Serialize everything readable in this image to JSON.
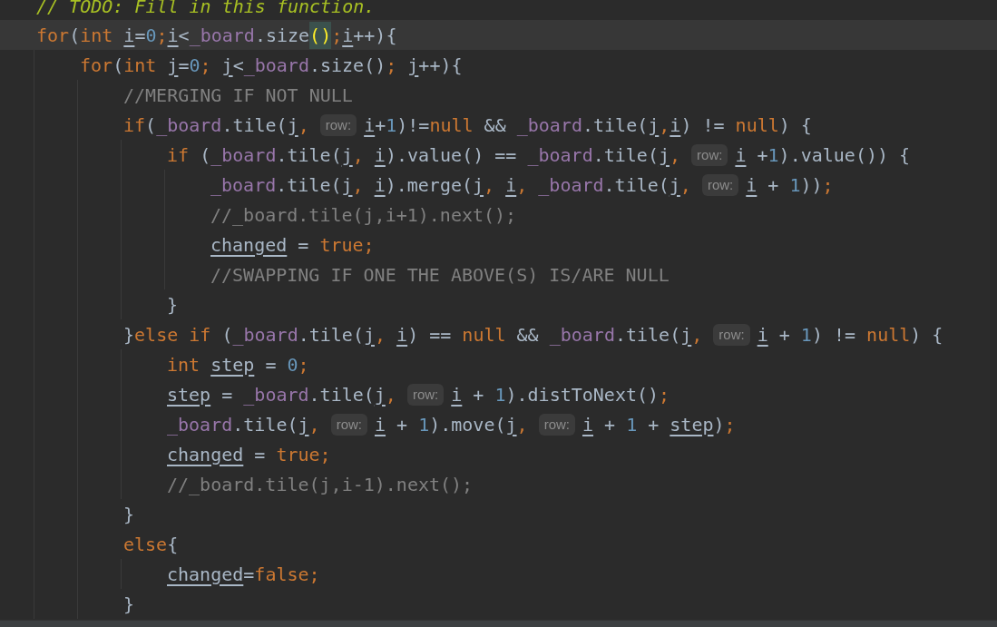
{
  "editor": {
    "lines": [
      {
        "current": false,
        "tokens": [
          {
            "text": "// TODO: Fill in this function.",
            "kind": "todo"
          }
        ]
      },
      {
        "current": true,
        "tokens": [
          {
            "text": "for",
            "kind": "kw"
          },
          {
            "text": "(",
            "kind": "text"
          },
          {
            "text": "int ",
            "kind": "kw"
          },
          {
            "text": "i",
            "kind": "var"
          },
          {
            "text": "=",
            "kind": "text"
          },
          {
            "text": "0",
            "kind": "num"
          },
          {
            "text": ";",
            "kind": "punct"
          },
          {
            "text": "i",
            "kind": "var"
          },
          {
            "text": "<",
            "kind": "text"
          },
          {
            "text": "_board",
            "kind": "field"
          },
          {
            "text": ".size",
            "kind": "text"
          },
          {
            "text": "()",
            "kind": "match"
          },
          {
            "text": ";",
            "kind": "punct"
          },
          {
            "text": "i",
            "kind": "var"
          },
          {
            "text": "++){",
            "kind": "text"
          }
        ]
      },
      {
        "current": false,
        "tokens": [
          {
            "text": "    for",
            "kind": "kw"
          },
          {
            "text": "(",
            "kind": "text"
          },
          {
            "text": "int ",
            "kind": "kw"
          },
          {
            "text": "j",
            "kind": "var"
          },
          {
            "text": "=",
            "kind": "text"
          },
          {
            "text": "0",
            "kind": "num"
          },
          {
            "text": "; ",
            "kind": "punct"
          },
          {
            "text": "j",
            "kind": "var"
          },
          {
            "text": "<",
            "kind": "text"
          },
          {
            "text": "_board",
            "kind": "field"
          },
          {
            "text": ".size()",
            "kind": "text"
          },
          {
            "text": "; ",
            "kind": "punct"
          },
          {
            "text": "j",
            "kind": "var"
          },
          {
            "text": "++){",
            "kind": "text"
          }
        ]
      },
      {
        "current": false,
        "tokens": [
          {
            "text": "        //MERGING IF NOT NULL",
            "kind": "comment"
          }
        ]
      },
      {
        "current": false,
        "tokens": [
          {
            "text": "        if",
            "kind": "kw"
          },
          {
            "text": "(",
            "kind": "text"
          },
          {
            "text": "_board",
            "kind": "field"
          },
          {
            "text": ".tile(",
            "kind": "text"
          },
          {
            "text": "j",
            "kind": "var"
          },
          {
            "text": ", ",
            "kind": "punct"
          },
          {
            "text": "row:",
            "kind": "hint"
          },
          {
            "text": "i",
            "kind": "var"
          },
          {
            "text": "+",
            "kind": "text"
          },
          {
            "text": "1",
            "kind": "num"
          },
          {
            "text": ")!=",
            "kind": "text"
          },
          {
            "text": "null",
            "kind": "kw"
          },
          {
            "text": " && ",
            "kind": "text"
          },
          {
            "text": "_board",
            "kind": "field"
          },
          {
            "text": ".tile(",
            "kind": "text"
          },
          {
            "text": "j",
            "kind": "var"
          },
          {
            "text": ",",
            "kind": "punct"
          },
          {
            "text": "i",
            "kind": "var"
          },
          {
            "text": ") != ",
            "kind": "text"
          },
          {
            "text": "null",
            "kind": "kw"
          },
          {
            "text": ") {",
            "kind": "text"
          }
        ]
      },
      {
        "current": false,
        "tokens": [
          {
            "text": "            if",
            "kind": "kw"
          },
          {
            "text": " (",
            "kind": "text"
          },
          {
            "text": "_board",
            "kind": "field"
          },
          {
            "text": ".tile(",
            "kind": "text"
          },
          {
            "text": "j",
            "kind": "var"
          },
          {
            "text": ", ",
            "kind": "punct"
          },
          {
            "text": "i",
            "kind": "var"
          },
          {
            "text": ").value() == ",
            "kind": "text"
          },
          {
            "text": "_board",
            "kind": "field"
          },
          {
            "text": ".tile(",
            "kind": "text"
          },
          {
            "text": "j",
            "kind": "var"
          },
          {
            "text": ", ",
            "kind": "punct"
          },
          {
            "text": "row:",
            "kind": "hint"
          },
          {
            "text": "i",
            "kind": "var"
          },
          {
            "text": " +",
            "kind": "text"
          },
          {
            "text": "1",
            "kind": "num"
          },
          {
            "text": ").value()) {",
            "kind": "text"
          }
        ]
      },
      {
        "current": false,
        "tokens": [
          {
            "text": "                _board",
            "kind": "field"
          },
          {
            "text": ".tile(",
            "kind": "text"
          },
          {
            "text": "j",
            "kind": "var"
          },
          {
            "text": ", ",
            "kind": "punct"
          },
          {
            "text": "i",
            "kind": "var"
          },
          {
            "text": ").merge(",
            "kind": "text"
          },
          {
            "text": "j",
            "kind": "var"
          },
          {
            "text": ", ",
            "kind": "punct"
          },
          {
            "text": "i",
            "kind": "var"
          },
          {
            "text": ", ",
            "kind": "punct"
          },
          {
            "text": "_board",
            "kind": "field"
          },
          {
            "text": ".tile(",
            "kind": "text"
          },
          {
            "text": "j",
            "kind": "var"
          },
          {
            "text": ", ",
            "kind": "punct"
          },
          {
            "text": "row:",
            "kind": "hint"
          },
          {
            "text": "i",
            "kind": "var"
          },
          {
            "text": " + ",
            "kind": "text"
          },
          {
            "text": "1",
            "kind": "num"
          },
          {
            "text": "))",
            "kind": "text"
          },
          {
            "text": ";",
            "kind": "punct"
          }
        ]
      },
      {
        "current": false,
        "tokens": [
          {
            "text": "                //_board.tile(j,i+1).next();",
            "kind": "comment"
          }
        ]
      },
      {
        "current": false,
        "tokens": [
          {
            "text": "                changed",
            "kind": "var"
          },
          {
            "text": " = ",
            "kind": "text"
          },
          {
            "text": "true",
            "kind": "kw"
          },
          {
            "text": ";",
            "kind": "punct"
          }
        ]
      },
      {
        "current": false,
        "tokens": [
          {
            "text": "                //SWAPPING IF ONE THE ABOVE(S) IS/ARE NULL",
            "kind": "comment"
          }
        ]
      },
      {
        "current": false,
        "tokens": [
          {
            "text": "            }",
            "kind": "text"
          }
        ]
      },
      {
        "current": false,
        "tokens": [
          {
            "text": "        }",
            "kind": "text"
          },
          {
            "text": "else if",
            "kind": "kw"
          },
          {
            "text": " (",
            "kind": "text"
          },
          {
            "text": "_board",
            "kind": "field"
          },
          {
            "text": ".tile(",
            "kind": "text"
          },
          {
            "text": "j",
            "kind": "var"
          },
          {
            "text": ", ",
            "kind": "punct"
          },
          {
            "text": "i",
            "kind": "var"
          },
          {
            "text": ") == ",
            "kind": "text"
          },
          {
            "text": "null",
            "kind": "kw"
          },
          {
            "text": " && ",
            "kind": "text"
          },
          {
            "text": "_board",
            "kind": "field"
          },
          {
            "text": ".tile(",
            "kind": "text"
          },
          {
            "text": "j",
            "kind": "var"
          },
          {
            "text": ", ",
            "kind": "punct"
          },
          {
            "text": "row:",
            "kind": "hint"
          },
          {
            "text": "i",
            "kind": "var"
          },
          {
            "text": " + ",
            "kind": "text"
          },
          {
            "text": "1",
            "kind": "num"
          },
          {
            "text": ") != ",
            "kind": "text"
          },
          {
            "text": "null",
            "kind": "kw"
          },
          {
            "text": ") {",
            "kind": "text"
          }
        ]
      },
      {
        "current": false,
        "tokens": [
          {
            "text": "            int ",
            "kind": "kw"
          },
          {
            "text": "step",
            "kind": "var"
          },
          {
            "text": " = ",
            "kind": "text"
          },
          {
            "text": "0",
            "kind": "num"
          },
          {
            "text": ";",
            "kind": "punct"
          }
        ]
      },
      {
        "current": false,
        "tokens": [
          {
            "text": "            step",
            "kind": "var"
          },
          {
            "text": " = ",
            "kind": "text"
          },
          {
            "text": "_board",
            "kind": "field"
          },
          {
            "text": ".tile(",
            "kind": "text"
          },
          {
            "text": "j",
            "kind": "var"
          },
          {
            "text": ", ",
            "kind": "punct"
          },
          {
            "text": "row:",
            "kind": "hint"
          },
          {
            "text": "i",
            "kind": "var"
          },
          {
            "text": " + ",
            "kind": "text"
          },
          {
            "text": "1",
            "kind": "num"
          },
          {
            "text": ").distToNext()",
            "kind": "text"
          },
          {
            "text": ";",
            "kind": "punct"
          }
        ]
      },
      {
        "current": false,
        "tokens": [
          {
            "text": "            _board",
            "kind": "field"
          },
          {
            "text": ".tile(",
            "kind": "text"
          },
          {
            "text": "j",
            "kind": "var"
          },
          {
            "text": ", ",
            "kind": "punct"
          },
          {
            "text": "row:",
            "kind": "hint"
          },
          {
            "text": "i",
            "kind": "var"
          },
          {
            "text": " + ",
            "kind": "text"
          },
          {
            "text": "1",
            "kind": "num"
          },
          {
            "text": ").move(",
            "kind": "text"
          },
          {
            "text": "j",
            "kind": "var"
          },
          {
            "text": ", ",
            "kind": "punct"
          },
          {
            "text": "row:",
            "kind": "hint"
          },
          {
            "text": "i",
            "kind": "var"
          },
          {
            "text": " + ",
            "kind": "text"
          },
          {
            "text": "1",
            "kind": "num"
          },
          {
            "text": " + ",
            "kind": "text"
          },
          {
            "text": "step",
            "kind": "var"
          },
          {
            "text": ")",
            "kind": "text"
          },
          {
            "text": ";",
            "kind": "punct"
          }
        ]
      },
      {
        "current": false,
        "tokens": [
          {
            "text": "            changed",
            "kind": "var"
          },
          {
            "text": " = ",
            "kind": "text"
          },
          {
            "text": "true",
            "kind": "kw"
          },
          {
            "text": ";",
            "kind": "punct"
          }
        ]
      },
      {
        "current": false,
        "tokens": [
          {
            "text": "            //_board.tile(j,i-1).next();",
            "kind": "comment"
          }
        ]
      },
      {
        "current": false,
        "tokens": [
          {
            "text": "        }",
            "kind": "text"
          }
        ]
      },
      {
        "current": false,
        "tokens": [
          {
            "text": "        else",
            "kind": "kw"
          },
          {
            "text": "{",
            "kind": "text"
          }
        ]
      },
      {
        "current": false,
        "tokens": [
          {
            "text": "            changed",
            "kind": "var"
          },
          {
            "text": "=",
            "kind": "text"
          },
          {
            "text": "false",
            "kind": "kw"
          },
          {
            "text": ";",
            "kind": "punct"
          }
        ]
      },
      {
        "current": false,
        "tokens": [
          {
            "text": "        }",
            "kind": "text"
          }
        ]
      }
    ]
  }
}
